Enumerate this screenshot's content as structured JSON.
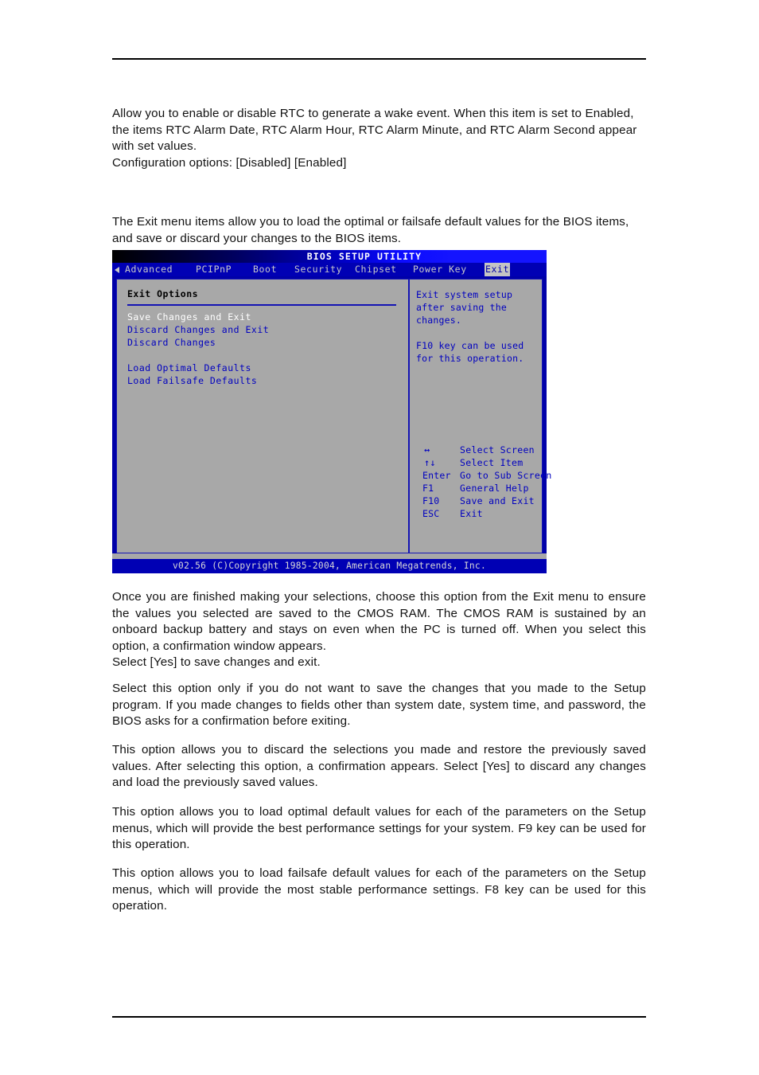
{
  "document": {
    "paragraphs": {
      "intro": "Allow you to enable or disable RTC to generate a wake event. When this item is set to Enabled, the items RTC Alarm Date, RTC Alarm Hour, RTC Alarm Minute, and RTC Alarm Second appear with set values.",
      "intro_config": "Configuration options: [Disabled] [Enabled]",
      "exit_menu": "The Exit menu items allow you to load the optimal or failsafe default values for the BIOS items, and save or discard your changes to the BIOS items.",
      "save_changes": "Once you are finished making your selections, choose this option from the Exit menu to ensure the values you selected are saved to the CMOS RAM. The CMOS RAM is sustained by an onboard backup battery and stays on even when the PC is turned off. When you select this option, a confirmation window appears.",
      "save_changes_tail": "Select [Yes] to save changes and exit.",
      "discard_changes_exit": "Select this option only if you do not want to save the changes that you made to the Setup program. If you made changes to fields other than system date, system time, and password, the BIOS asks for a confirmation before exiting.",
      "discard_changes": "This option allows you to discard the selections you made and restore the previously saved values. After selecting this option, a confirmation appears. Select [Yes] to discard any changes and load the previously saved values.",
      "load_optimal": "This option allows you to load optimal default values for each of the parameters on the Setup menus, which will provide the best performance settings for your system. F9 key can be used for this operation.",
      "load_failsafe": "This option allows you to load failsafe default values for each of the parameters on the Setup menus, which will provide the most stable performance settings. F8 key can be used for this operation."
    }
  },
  "bios": {
    "title": "BIOS SETUP UTILITY",
    "menu_tabs": [
      {
        "label": "Advanced",
        "selected": false
      },
      {
        "label": "PCIPnP",
        "selected": false
      },
      {
        "label": "Boot",
        "selected": false
      },
      {
        "label": "Security",
        "selected": false
      },
      {
        "label": "Chipset",
        "selected": false
      },
      {
        "label": "Power Key",
        "selected": false
      },
      {
        "label": "Exit",
        "selected": true
      }
    ],
    "left_panel": {
      "heading": "Exit Options",
      "items": [
        {
          "label": "Save Changes and Exit",
          "highlighted": true
        },
        {
          "label": "Discard Changes and Exit",
          "highlighted": false
        },
        {
          "label": "Discard Changes",
          "highlighted": false
        },
        {
          "label": "Load Optimal Defaults",
          "highlighted": false
        },
        {
          "label": "Load Failsafe Defaults",
          "highlighted": false
        }
      ]
    },
    "help_panel": {
      "line1": "Exit system setup after saving the changes.",
      "line2": "F10 key can be used for this operation.",
      "legend": [
        {
          "key": "↔",
          "desc": "Select Screen",
          "symbol": true
        },
        {
          "key": "↑↓",
          "desc": "Select Item",
          "symbol": true
        },
        {
          "key": "Enter",
          "desc": "Go to Sub Screen",
          "symbol": false
        },
        {
          "key": "F1",
          "desc": "General Help",
          "symbol": false
        },
        {
          "key": "F10",
          "desc": "Save and Exit",
          "symbol": false
        },
        {
          "key": "ESC",
          "desc": "Exit",
          "symbol": false
        }
      ]
    },
    "footer": "v02.56 (C)Copyright 1985-2004, American Megatrends, Inc.",
    "colors": {
      "menubar_blue": "#0000b4",
      "panel_gray": "#a8a8a8",
      "text_blue": "#0000c0",
      "highlight_white": "#ffffff",
      "border_blue": "#1414b4"
    }
  }
}
